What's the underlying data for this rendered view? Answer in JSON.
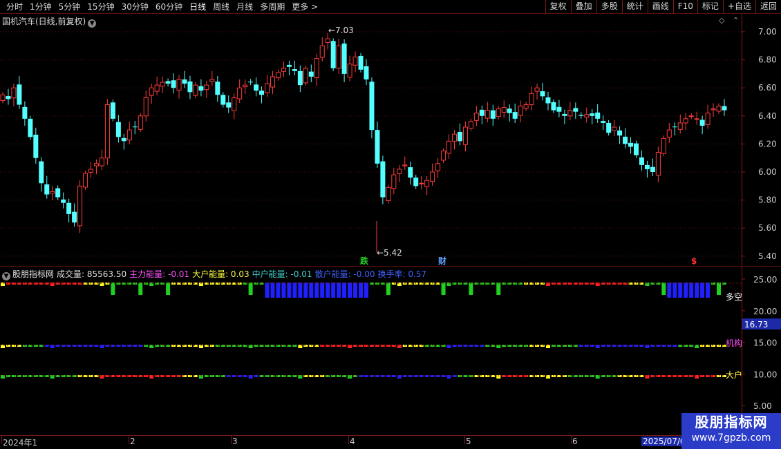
{
  "toolbar": {
    "period_tabs": [
      "分时",
      "1分钟",
      "5分钟",
      "15分钟",
      "30分钟",
      "60分钟",
      "日线",
      "周线",
      "月线",
      "多周期",
      "更多 >"
    ],
    "active_tab": "日线",
    "buttons": [
      "复权",
      "叠加",
      "多股",
      "统计",
      "画线",
      "F10",
      "标记",
      "+自选",
      "返回"
    ]
  },
  "main": {
    "title": "国机汽车(日线,前复权)",
    "high_marker": "7.03",
    "low_marker": "5.42",
    "event_tags": [
      {
        "text": "跌",
        "color": "#22cc22"
      },
      {
        "text": "财",
        "color": "#5aa0ff"
      },
      {
        "text": "$",
        "color": "#ff3030"
      }
    ],
    "price_axis": [
      "7.00",
      "6.80",
      "6.60",
      "6.40",
      "6.20",
      "6.00",
      "5.80",
      "5.60",
      "5.40"
    ]
  },
  "indicator": {
    "legend": [
      {
        "text": "股朋指标网",
        "color": "#e0e0e0"
      },
      {
        "text": "成交量: 85563.50",
        "color": "#e0e0e0"
      },
      {
        "text": "主力能量: -0.01",
        "color": "#ff50ff"
      },
      {
        "text": "大户能量: 0.03",
        "color": "#ffff40"
      },
      {
        "text": "中户能量: -0.01",
        "color": "#40d0d0"
      },
      {
        "text": "散户能量: -0.00",
        "color": "#4060ff"
      },
      {
        "text": "换手率: 0.57",
        "color": "#4060ff"
      }
    ],
    "axis": [
      "25.00",
      "20.00",
      "15.00",
      "10.00",
      "5.00"
    ],
    "current_value": "16.73",
    "side_labels": [
      {
        "text": "多空",
        "color": "#ffffff"
      },
      {
        "text": "机构",
        "color": "#ff50ff"
      },
      {
        "text": "大户",
        "color": "#ffff40"
      }
    ]
  },
  "date_axis": {
    "labels": [
      "2024年1",
      "2",
      "3",
      "4",
      "5",
      "6"
    ],
    "current_date": "2025/07/0"
  },
  "watermark": {
    "line1": "股朋指标网",
    "line2": "www.7gpzb.com"
  },
  "colors": {
    "up": "#ff3c3c",
    "down": "#54ffff",
    "grid": "#6a1010",
    "axis": "#8a1a1a"
  }
}
